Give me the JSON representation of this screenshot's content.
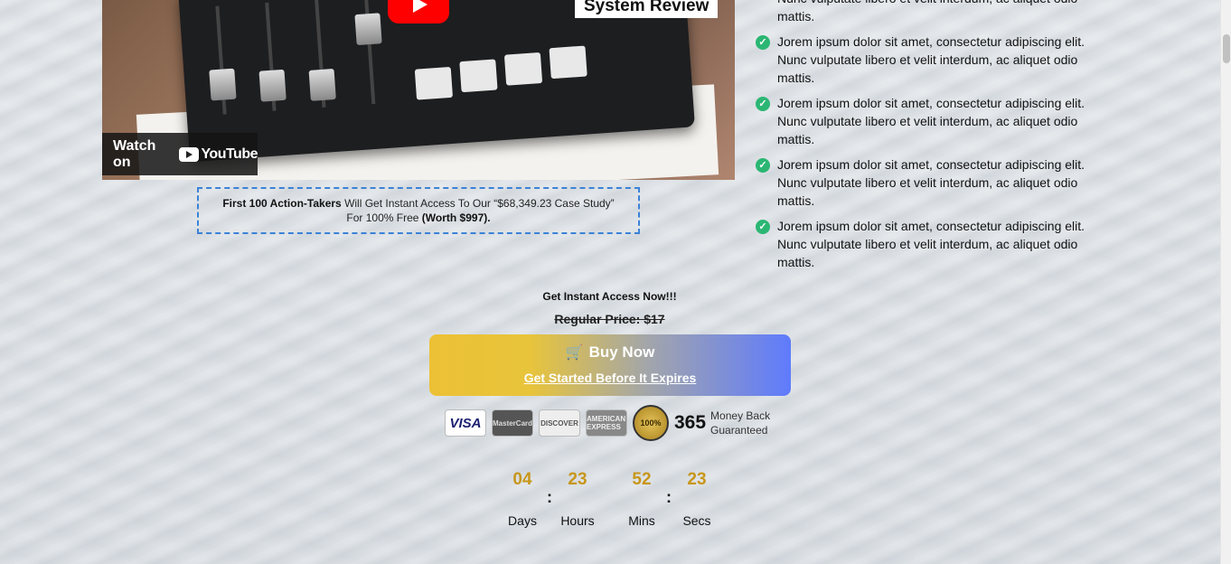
{
  "video": {
    "title": "System Review",
    "watch_on": "Watch on",
    "youtube": "YouTube"
  },
  "offer": {
    "lead": "First 100 Action-Takers",
    "text": " Will Get Instant Access To Our “$68,349.23 Case Study”",
    "line2": "For 100% Free ",
    "worth": "(Worth $997)."
  },
  "bullets": {
    "top_partial": "Nunc vulputate libero et velit interdum, ac aliquet odio mattis.",
    "items": [
      "Jorem ipsum dolor sit amet, consectetur adipiscing elit. Nunc vulputate libero et velit interdum, ac aliquet odio mattis.",
      "Jorem ipsum dolor sit amet, consectetur adipiscing elit. Nunc vulputate libero et velit interdum, ac aliquet odio mattis.",
      "Jorem ipsum dolor sit amet, consectetur adipiscing elit. Nunc vulputate libero et velit interdum, ac aliquet odio mattis.",
      "Jorem ipsum dolor sit amet, consectetur adipiscing elit. Nunc vulputate libero et velit interdum, ac aliquet odio mattis."
    ]
  },
  "cta": {
    "get_instant": "Get Instant Access Now!!!",
    "regular_price": "Regular Price: $17",
    "buy_label": "Buy Now",
    "sub_label": "Get Started Before It Expires",
    "gradient_start": "#ecc136",
    "gradient_end": "#5f7bfd"
  },
  "payments": {
    "visa": "VISA",
    "mastercard": "MasterCard",
    "discover": "DISCOVER",
    "amex": "AMERICAN EXPRESS",
    "seal": "100%",
    "days": "365",
    "guarantee_line1": "Money Back",
    "guarantee_line2": "Guaranteed"
  },
  "countdown": {
    "days": "04",
    "hours": "23",
    "mins": "52",
    "secs": "23",
    "days_label": "Days",
    "hours_label": "Hours",
    "mins_label": "Mins",
    "secs_label": "Secs",
    "separator": ":",
    "number_color": "#c8961a"
  }
}
